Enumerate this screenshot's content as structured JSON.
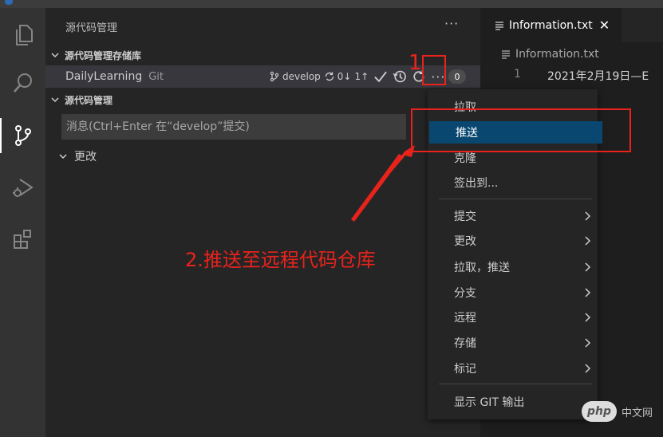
{
  "sidebar": {
    "title": "源代码管理",
    "more_glyph": "···",
    "repos_section": "源代码管理存储库",
    "repo": {
      "name": "DailyLearning",
      "type": "Git",
      "branch": "develop",
      "sync_down": "0↓",
      "sync_up": "1↑",
      "badge": "0"
    },
    "scm_section": "源代码管理",
    "message_placeholder": "消息(Ctrl+Enter 在“develop”提交)",
    "changes": "更改"
  },
  "editor": {
    "tab_title": "Information.txt",
    "tab_close": "✕",
    "breadcrumb": "Information.txt",
    "line_number": "1",
    "line_text": "2021年2月19日—E"
  },
  "menu": {
    "items": [
      {
        "label": "拉取",
        "submenu": false
      },
      {
        "label": "推送",
        "submenu": false,
        "selected": true
      },
      {
        "label": "克隆",
        "submenu": false
      },
      {
        "label": "签出到...",
        "submenu": false
      },
      {
        "label": "提交",
        "submenu": true
      },
      {
        "label": "更改",
        "submenu": true
      },
      {
        "label": "拉取，推送",
        "submenu": true
      },
      {
        "label": "分支",
        "submenu": true
      },
      {
        "label": "远程",
        "submenu": true
      },
      {
        "label": "存储",
        "submenu": true
      },
      {
        "label": "标记",
        "submenu": true
      },
      {
        "label": "显示 GIT 输出",
        "submenu": false
      }
    ]
  },
  "annotations": {
    "step1": "1",
    "step2": "2.推送至远程代码仓库",
    "color": "#e8231c"
  },
  "watermark": {
    "logo": "php",
    "text": "中文网"
  },
  "colors": {
    "activity_bar": "#333333",
    "sidebar": "#252526",
    "editor": "#1e1e1e",
    "menu_selection": "#094771"
  }
}
